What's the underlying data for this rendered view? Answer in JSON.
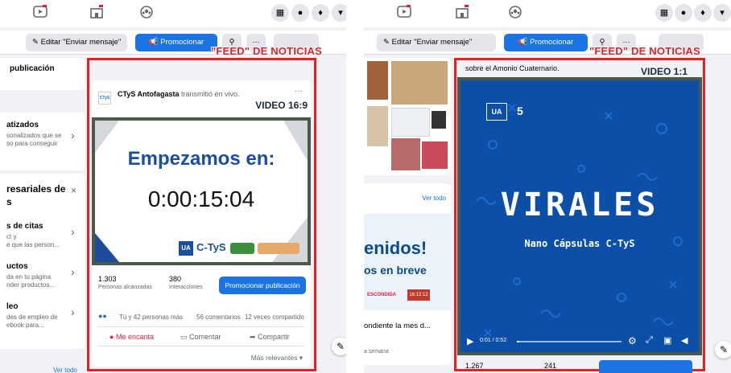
{
  "left": {
    "toolbar": {
      "edit_label": "Editar \"Enviar mensaje\"",
      "promote_label": "Promocionar"
    },
    "feed_label": "\"FEED\" DE NOTICIAS",
    "sidebar": {
      "s1_title": "publicación",
      "s2_title": "atizados",
      "s2_text_1": "sonalizados que se",
      "s2_text_2": "so para conseguir",
      "s3_title_1": "resariales de",
      "s3_title_2": "s",
      "s4_title": "s de citas",
      "s4_text_1": "ct y",
      "s4_text_2": "e que las person...",
      "s5_title": "uctos",
      "s5_text_1": "da en tu página",
      "s5_text_2": "nder productos...",
      "s6_title": "leo",
      "s6_text_1": "des de empleo de",
      "s6_text_2": "ebook para...",
      "see_all": "Ver todo"
    },
    "post": {
      "page_name": "CTyS Antofagasta",
      "action": "transmitió en vivo.",
      "format_tag": "VIDEO 16:9",
      "video_title": "Empezamos en:",
      "video_timer": "0:00:15:04",
      "logo_ua": "UA",
      "logo_ctys": "C-TyS",
      "reach_value": "1.303",
      "reach_label": "Personas alcanzadas",
      "interactions_value": "380",
      "interactions_label": "Interacciones",
      "promote_button": "Promocionar publicación",
      "reactions": "Tú y 42 personas más",
      "comments": "56 comentarios",
      "shares": "12 veces compartido",
      "like_label": "Me encanta",
      "comment_label": "Comentar",
      "share_label": "Compartir",
      "sort_label": "Más relevantes"
    }
  },
  "right": {
    "toolbar": {
      "edit_label": "Editar \"Enviar mensaje\"",
      "promote_label": "Promocionar"
    },
    "feed_label": "\"FEED\" DE NOTICIAS",
    "sidebar": {
      "see_all": "Ver todo",
      "promo_big_1": "enidos!",
      "promo_big_2": "os en breve",
      "promo_small": "ESCONDIDA",
      "promo_time": "16:12:12",
      "promo_caption": "ondiente la mes d...",
      "promo_meta": "a semana"
    },
    "post": {
      "caption": "sobre el Amonio Cuaternario.",
      "format_tag": "VIDEO 1:1",
      "logo_ua": "UA",
      "logo_num": "5",
      "video_title": "VIRALES",
      "video_subtitle": "Nano Cápsulas C-TyS",
      "time_display": "0:01 / 0:52",
      "reach_value": "1.267",
      "interactions_value": "241"
    }
  },
  "colors": {
    "fb_blue": "#1b74e4",
    "highlight_red": "#e41f26",
    "video_blue": "#0b4fa8"
  },
  "icons": [
    "watch-icon",
    "marketplace-icon",
    "groups-icon",
    "grid-icon",
    "messenger-icon",
    "bell-icon",
    "caret-icon",
    "pencil-icon",
    "megaphone-icon",
    "search-icon",
    "more-icon",
    "like-icon",
    "heart-icon",
    "comment-icon",
    "share-icon",
    "play-icon",
    "gear-icon",
    "fullscreen-icon",
    "pip-icon",
    "volume-icon",
    "new-message-icon"
  ]
}
